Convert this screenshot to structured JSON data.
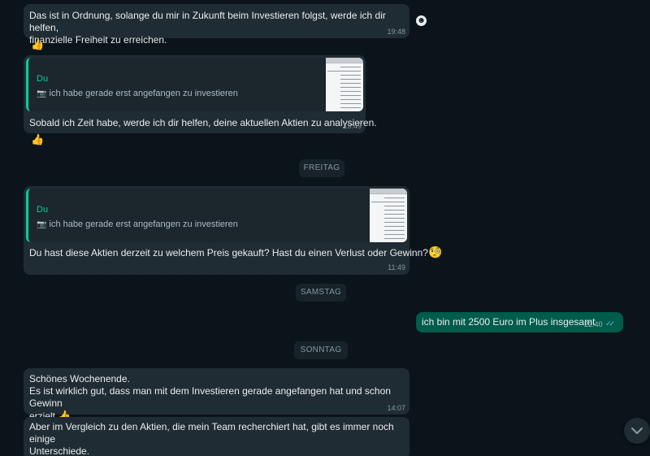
{
  "messages": {
    "m1": {
      "text_line1": "Das ist in Ordnung, solange du mir in Zukunft beim Investieren folgst, werde ich dir helfen,",
      "text_line2": "finanzielle Freiheit zu erreichen.",
      "time": "19:48",
      "reaction": "👍"
    },
    "m2": {
      "quote_author": "Du",
      "quote_text": "ich habe gerade erst angefangen zu investieren",
      "text": "Sobald ich Zeit habe, werde ich dir helfen, deine aktuellen Aktien zu analysieren.",
      "time": "19:49",
      "reaction": "👍"
    },
    "m3": {
      "quote_author": "Du",
      "quote_text": "ich habe gerade erst angefangen zu investieren",
      "text": "Du hast diese Aktien derzeit zu welchem Preis gekauft? Hast du einen Verlust oder Gewinn?",
      "emoji": "🧐",
      "time": "11:49"
    },
    "m4": {
      "text": "ich bin mit 2500 Euro im Plus insgesamt",
      "time": "22:40",
      "ticks": "✓✓"
    },
    "m5": {
      "line1": "Schönes Wochenende.",
      "line2": "Es ist wirklich gut, dass man mit dem Investieren gerade angefangen hat und schon Gewinn",
      "line3": "erzielt.",
      "emoji": "👍",
      "time": "14:07"
    },
    "m6": {
      "line1": "Aber im Vergleich zu den Aktien, die mein Team recherchiert hat, gibt es immer noch einige",
      "line2": "Unterschiede."
    }
  },
  "dates": {
    "friday": "FREITAG",
    "saturday": "SAMSTAG",
    "sunday": "SONNTAG"
  },
  "icons": {
    "camera": "📷",
    "emoji_button": "☻",
    "scroll_down": "chevron-down-icon"
  },
  "colors": {
    "background": "#0b141a",
    "incoming": "#202c33",
    "outgoing": "#005c4b",
    "accent": "#06cf9c",
    "read_ticks": "#53bdeb"
  }
}
